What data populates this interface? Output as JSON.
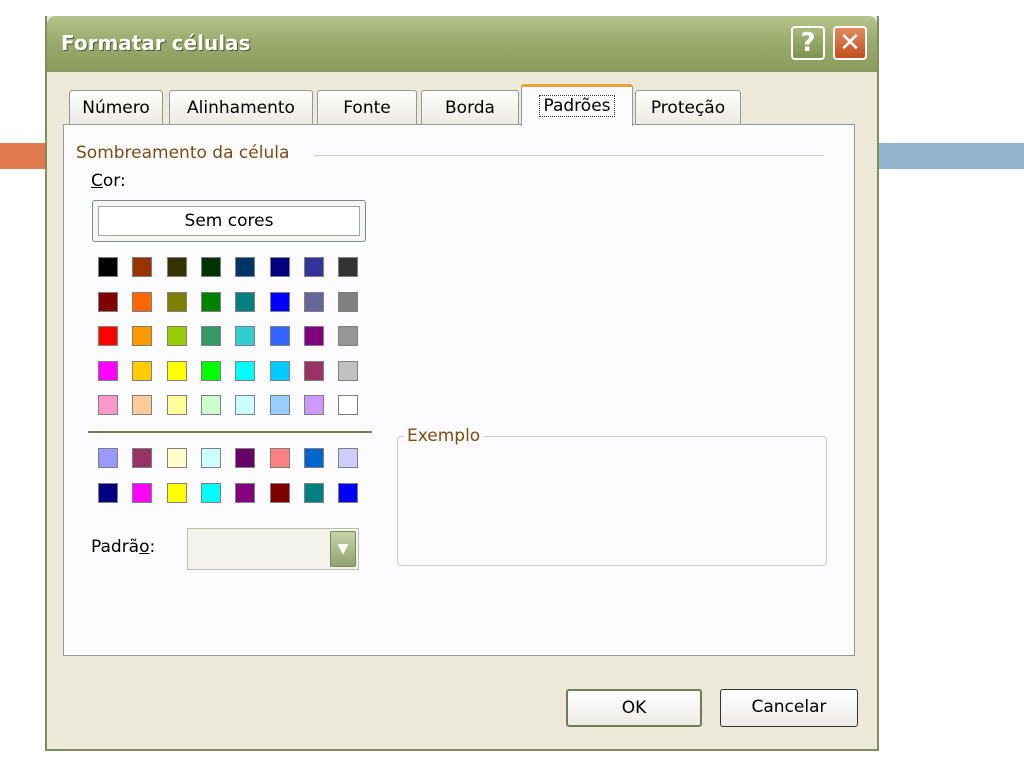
{
  "window": {
    "title": "Formatar células"
  },
  "tabs": [
    "Número",
    "Alinhamento",
    "Fonte",
    "Borda",
    "Padrões",
    "Proteção"
  ],
  "active_tab": "Padrões",
  "shading": {
    "group_label": "Sombreamento da célula",
    "color_label": "Cor:",
    "no_color_label": "Sem cores",
    "palette_main": [
      [
        "#000000",
        "#993300",
        "#333300",
        "#003300",
        "#003366",
        "#000080",
        "#333399",
        "#333333"
      ],
      [
        "#800000",
        "#FF6600",
        "#808000",
        "#008000",
        "#008080",
        "#0000FF",
        "#666699",
        "#808080"
      ],
      [
        "#FF0000",
        "#FF9900",
        "#99CC00",
        "#339966",
        "#33CCCC",
        "#3366FF",
        "#800080",
        "#969696"
      ],
      [
        "#FF00FF",
        "#FFCC00",
        "#FFFF00",
        "#00FF00",
        "#00FFFF",
        "#00CCFF",
        "#993366",
        "#C0C0C0"
      ],
      [
        "#FF99CC",
        "#FFCC99",
        "#FFFF99",
        "#CCFFCC",
        "#CCFFFF",
        "#99CCFF",
        "#CC99FF",
        "#FFFFFF"
      ]
    ],
    "palette_chart": [
      [
        "#9999FF",
        "#993366",
        "#FFFFCC",
        "#CCFFFF",
        "#660066",
        "#FF8080",
        "#0066CC",
        "#CCCCFF"
      ],
      [
        "#000080",
        "#FF00FF",
        "#FFFF00",
        "#00FFFF",
        "#800080",
        "#800000",
        "#008080",
        "#0000FF"
      ]
    ],
    "pattern_label": "Padrão:",
    "pattern_value": ""
  },
  "sample": {
    "label": "Exemplo"
  },
  "buttons": {
    "ok": "OK",
    "cancel": "Cancelar"
  },
  "colors": {
    "tab_highlight": "#e9a23b",
    "group_text": "#7a4d10",
    "titlebar": "#9aab6c"
  }
}
